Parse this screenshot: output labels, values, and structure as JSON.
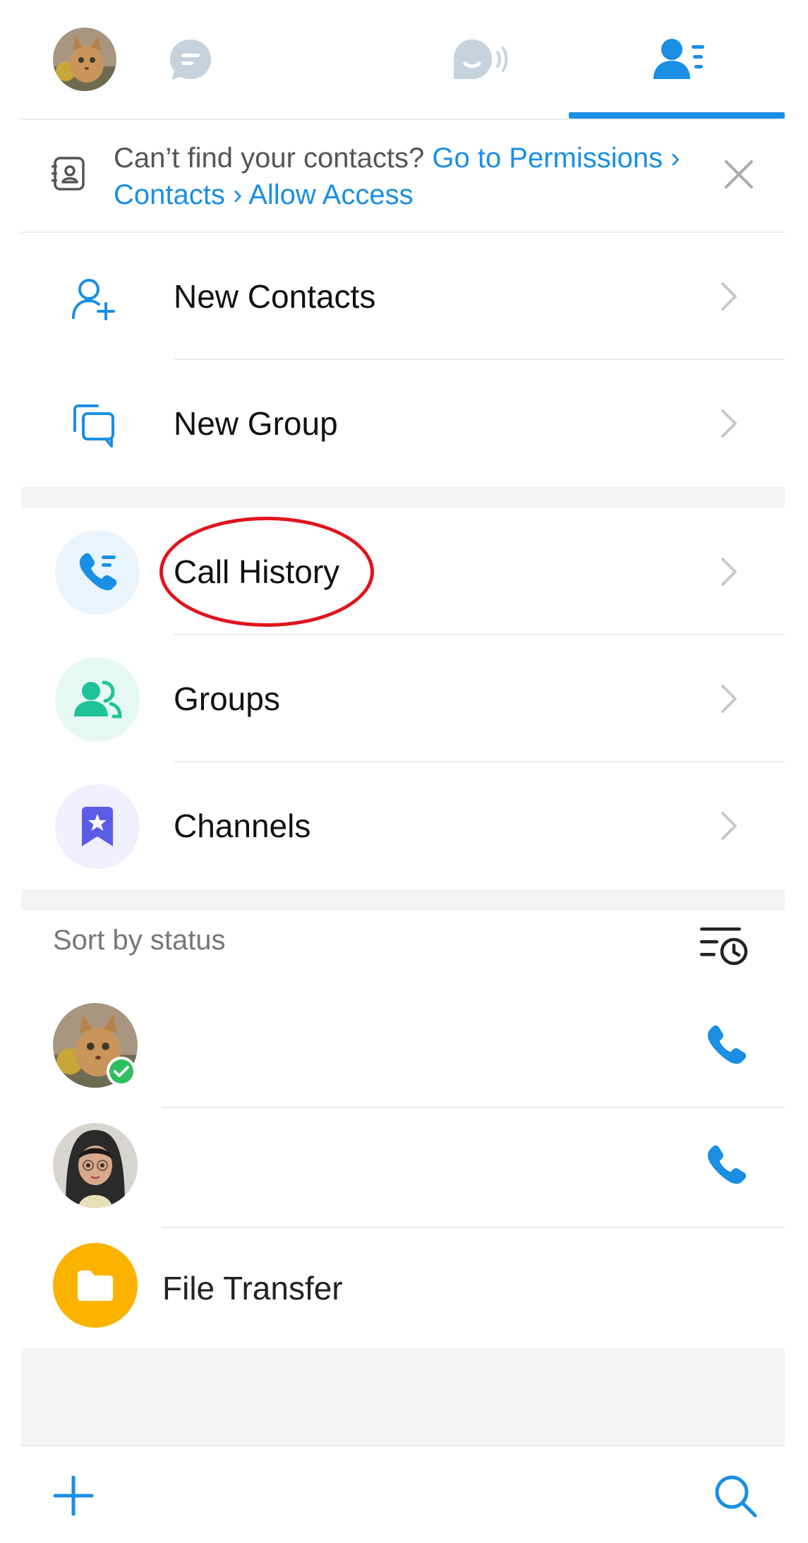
{
  "tabs": [
    {
      "name": "profile-avatar"
    },
    {
      "name": "chats-icon"
    },
    {
      "name": "calls-icon"
    },
    {
      "name": "contacts-icon",
      "active": true
    }
  ],
  "banner": {
    "text": "Can’t find your contacts? ",
    "link_text": "Go to Permissions › Contacts › Allow Access"
  },
  "menu": [
    {
      "label": "New Contacts",
      "icon": "add-contact-icon"
    },
    {
      "label": "New Group",
      "icon": "new-group-icon"
    }
  ],
  "menu2": [
    {
      "label": "Call History",
      "icon": "call-history-icon",
      "circle": "#e9f4fd"
    },
    {
      "label": "Groups",
      "icon": "groups-icon",
      "circle": "#e6f8f3"
    },
    {
      "label": "Channels",
      "icon": "channels-icon",
      "circle": "#efeffd"
    }
  ],
  "sort": {
    "label": "Sort by status"
  },
  "contacts": [
    {
      "name": "",
      "avatar": "cat-avatar",
      "online": true
    },
    {
      "name": "",
      "avatar": "girl-avatar",
      "online": false
    },
    {
      "name": "File Transfer",
      "avatar": "folder-avatar"
    }
  ],
  "colors": {
    "accent": "#1a8fe3",
    "green": "#1fc39a",
    "purple": "#5b5ce6",
    "folder": "#fbb300",
    "annotation": "#e0141e"
  }
}
